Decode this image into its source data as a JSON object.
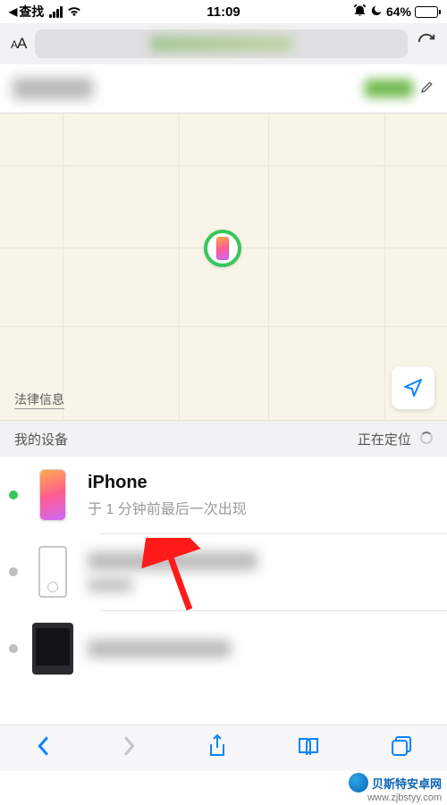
{
  "statusbar": {
    "back_app": "查找",
    "time": "11:09",
    "battery_pct": "64%"
  },
  "map": {
    "legal_label": "法律信息"
  },
  "section": {
    "title": "我的设备",
    "locating_label": "正在定位"
  },
  "devices": [
    {
      "name": "iPhone",
      "subtitle": "于 1 分钟前最后一次出现",
      "online": true,
      "kind": "iphone-color"
    },
    {
      "name": "",
      "subtitle": "",
      "online": false,
      "kind": "white-device"
    },
    {
      "name": "",
      "subtitle": "",
      "online": false,
      "kind": "ipad-black"
    }
  ],
  "watermark": {
    "brand": "贝斯特安卓网",
    "url": "www.zjbstyy.com"
  }
}
